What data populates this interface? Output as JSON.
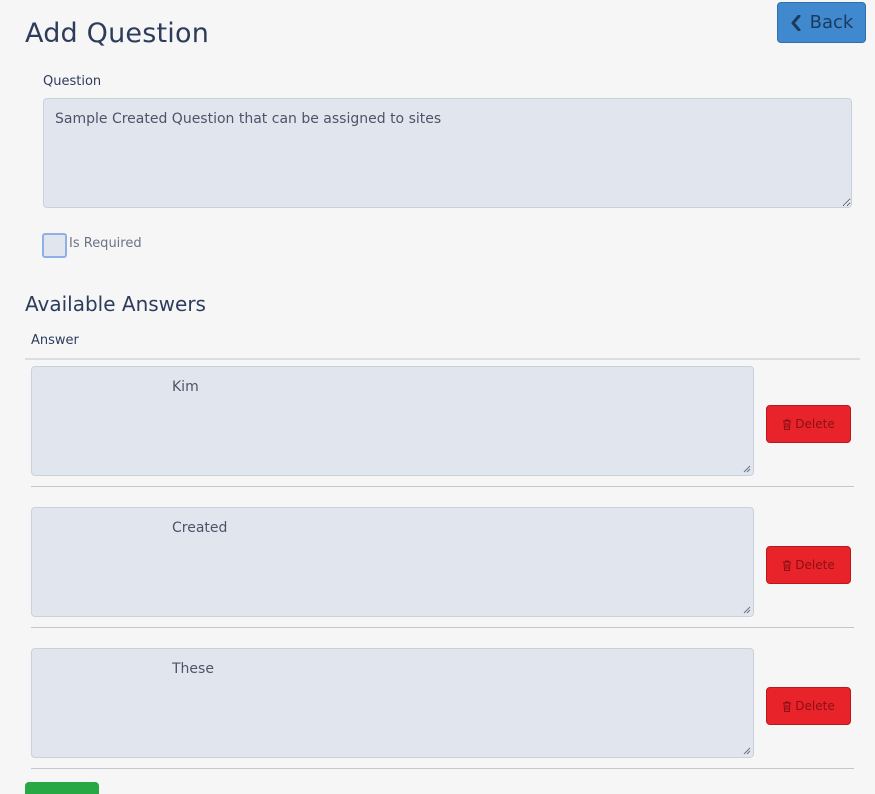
{
  "header": {
    "title": "Add Question",
    "back_label": "Back"
  },
  "question": {
    "label": "Question",
    "value": "Sample Created Question that can be assigned to sites"
  },
  "required": {
    "label": "Is Required",
    "checked": false
  },
  "answers": {
    "title": "Available Answers",
    "column_header": "Answer",
    "delete_label": "Delete",
    "items": [
      {
        "value": "Kim"
      },
      {
        "value": "Created"
      },
      {
        "value": "These"
      }
    ]
  },
  "colors": {
    "back_button": "#4089cf",
    "delete_button": "#e8242a",
    "add_button": "#27a844",
    "field_background": "#e1e5ee"
  }
}
